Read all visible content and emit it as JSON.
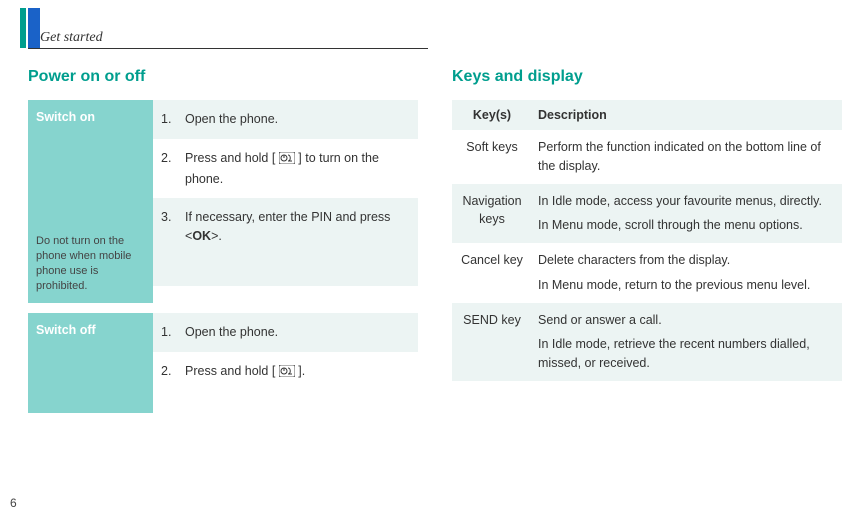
{
  "header": {
    "running_title": "Get started",
    "page_number": "6"
  },
  "left": {
    "title": "Power on or off",
    "switch_on": {
      "label": "Switch on",
      "note": "Do not turn on the phone when mobile phone use is prohibited.",
      "steps": [
        {
          "num": "1.",
          "text": "Open the phone."
        },
        {
          "num": "2.",
          "text_before": "Press and hold [ ",
          "text_after": " ] to turn on the phone.",
          "icon": "power-end-icon"
        },
        {
          "num": "3.",
          "text_before": "If necessary, enter the PIN and press <",
          "ok": "OK",
          "text_after": ">."
        }
      ]
    },
    "switch_off": {
      "label": "Switch off",
      "steps": [
        {
          "num": "1.",
          "text": "Open the phone."
        },
        {
          "num": "2.",
          "text_before": "Press and hold [ ",
          "text_after": " ].",
          "icon": "power-end-icon"
        }
      ]
    }
  },
  "right": {
    "title": "Keys and display",
    "headers": {
      "keys": "Key(s)",
      "desc": "Description"
    },
    "rows": [
      {
        "key": "Soft keys",
        "desc": "Perform the function indicated on the bottom line of the display."
      },
      {
        "key": "Navigation keys",
        "desc": "In Idle mode, access your favourite menus, directly.",
        "desc2": "In Menu mode, scroll through the menu options."
      },
      {
        "key": "Cancel key",
        "desc": "Delete characters from the display.",
        "desc2": "In Menu mode, return to the previous menu level."
      },
      {
        "key": "SEND key",
        "desc": "Send or answer a call.",
        "desc2": "In Idle mode, retrieve the recent numbers dialled, missed, or received."
      }
    ]
  }
}
